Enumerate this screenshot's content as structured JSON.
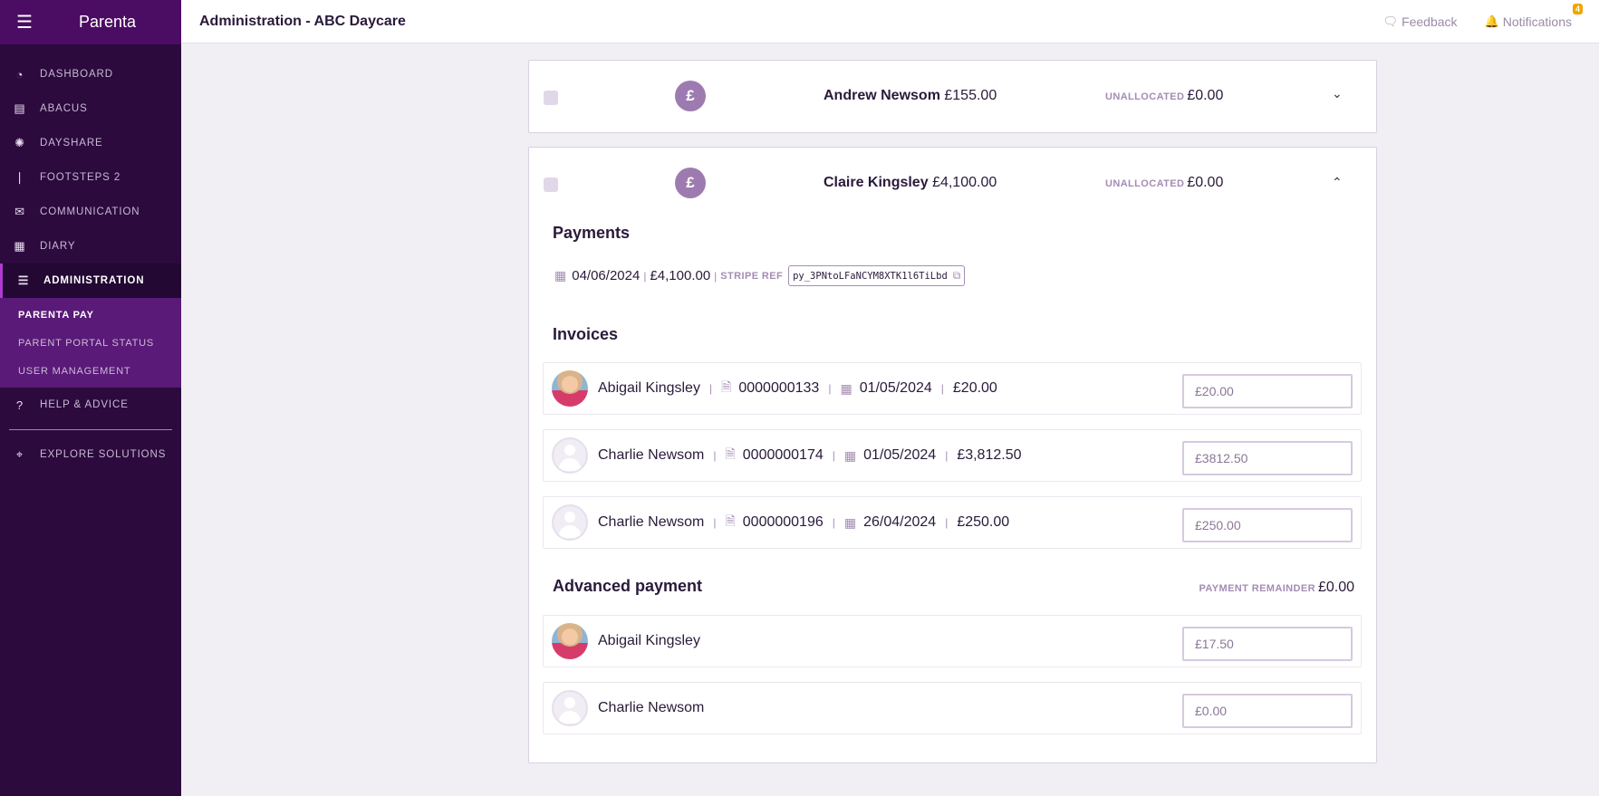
{
  "sidebar": {
    "brand": "Parenta",
    "items": [
      {
        "label": "Dashboard",
        "icon": "gauge-icon",
        "glyph": "◔"
      },
      {
        "label": "Abacus",
        "icon": "calculator-icon",
        "glyph": "▤"
      },
      {
        "label": "Dayshare",
        "icon": "sun-icon",
        "glyph": "✺"
      },
      {
        "label": "Footsteps 2",
        "icon": "footprint-icon",
        "glyph": "❘"
      },
      {
        "label": "Communication",
        "icon": "envelope-icon",
        "glyph": "✉"
      },
      {
        "label": "Diary",
        "icon": "calendar-icon",
        "glyph": "▦"
      },
      {
        "label": "Administration",
        "icon": "sliders-icon",
        "glyph": "☰"
      }
    ],
    "sub_items": [
      {
        "label": "Parenta Pay"
      },
      {
        "label": "Parent Portal Status"
      },
      {
        "label": "User Management"
      }
    ],
    "help": {
      "label": "Help & Advice",
      "icon": "question-icon",
      "glyph": "?"
    },
    "explore": {
      "label": "Explore Solutions",
      "icon": "telescope-icon",
      "glyph": "⌖"
    }
  },
  "topbar": {
    "title": "Administration - ABC Daycare",
    "feedback": "Feedback",
    "notifications": "Notifications",
    "notification_count": "4"
  },
  "cards": [
    {
      "payer_name": "Andrew Newsom",
      "payer_amount": "£155.00",
      "unallocated_label": "UNALLOCATED",
      "unallocated_value": "£0.00"
    },
    {
      "payer_name": "Claire Kingsley",
      "payer_amount": "£4,100.00",
      "unallocated_label": "UNALLOCATED",
      "unallocated_value": "£0.00"
    }
  ],
  "payments": {
    "heading": "Payments",
    "date": "04/06/2024",
    "amount": "£4,100.00",
    "stripe_ref_label": "STRIPE REF",
    "stripe_ref": "py_3PNtoLFaNCYM8XTK1l6TiLbd"
  },
  "invoices": {
    "heading": "Invoices",
    "rows": [
      {
        "child": "Abigail Kingsley",
        "number": "0000000133",
        "date": "01/05/2024",
        "amount": "£20.00",
        "input": "£20.00"
      },
      {
        "child": "Charlie Newsom",
        "number": "0000000174",
        "date": "01/05/2024",
        "amount": "£3,812.50",
        "input": "£3812.50"
      },
      {
        "child": "Charlie Newsom",
        "number": "0000000196",
        "date": "26/04/2024",
        "amount": "£250.00",
        "input": "£250.00"
      }
    ]
  },
  "advanced": {
    "heading": "Advanced payment",
    "remainder_label": "PAYMENT REMAINDER",
    "remainder_value": "£0.00",
    "rows": [
      {
        "child": "Abigail Kingsley",
        "input": "£17.50"
      },
      {
        "child": "Charlie Newsom",
        "input": "£0.00"
      }
    ]
  }
}
